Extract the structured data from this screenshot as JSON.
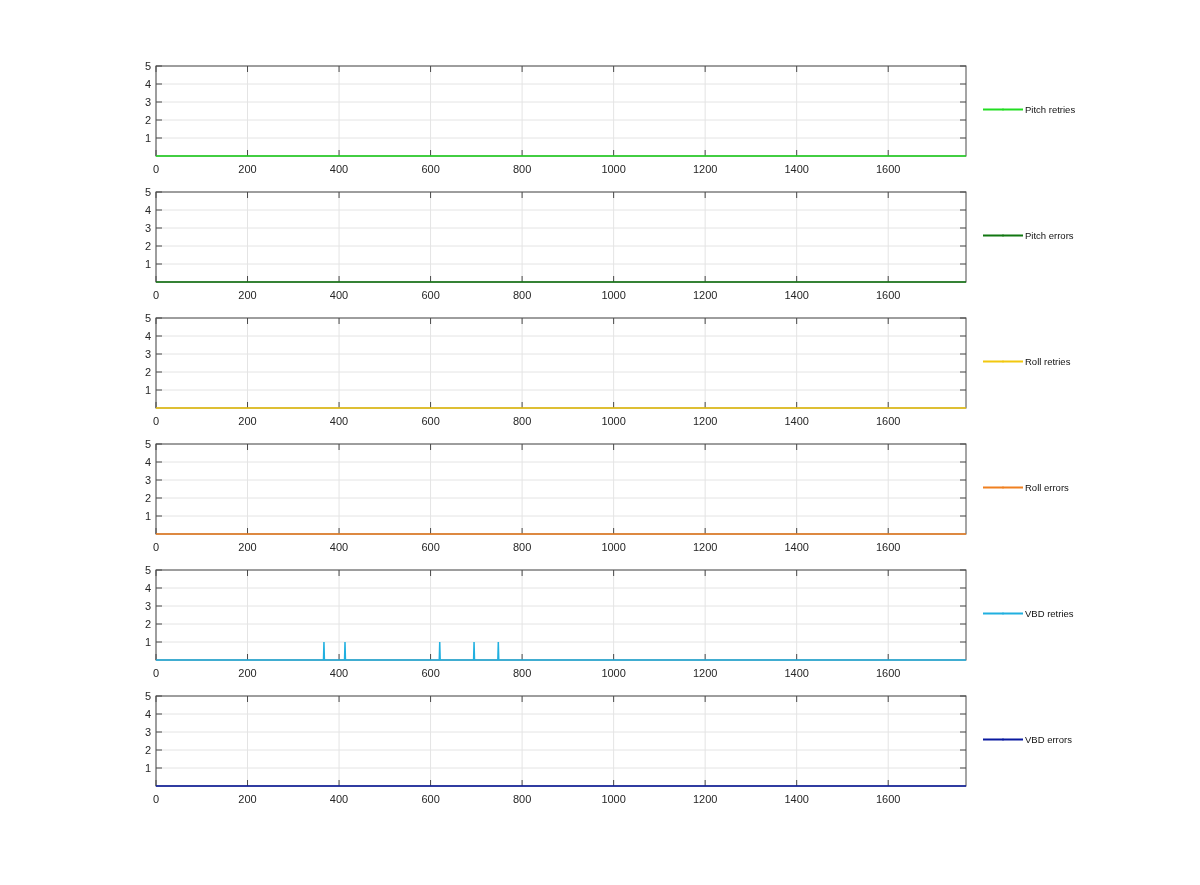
{
  "charts": [
    {
      "chart_data": {
        "type": "line",
        "x": [
          0,
          1770
        ],
        "series": [
          {
            "name": "Pitch retries",
            "color": "#22dd22",
            "values": [
              0,
              0
            ]
          }
        ],
        "xlim": [
          0,
          1770
        ],
        "ylim": [
          0,
          5
        ],
        "xticks": [
          0,
          200,
          400,
          600,
          800,
          1000,
          1200,
          1400,
          1600
        ],
        "yticks": [
          1,
          2,
          3,
          4,
          5
        ],
        "grid": true
      }
    },
    {
      "chart_data": {
        "type": "line",
        "x": [
          0,
          1770
        ],
        "series": [
          {
            "name": "Pitch errors",
            "color": "#117711",
            "values": [
              0,
              0
            ]
          }
        ],
        "xlim": [
          0,
          1770
        ],
        "ylim": [
          0,
          5
        ],
        "xticks": [
          0,
          200,
          400,
          600,
          800,
          1000,
          1200,
          1400,
          1600
        ],
        "yticks": [
          1,
          2,
          3,
          4,
          5
        ],
        "grid": true
      }
    },
    {
      "chart_data": {
        "type": "line",
        "x": [
          0,
          1770
        ],
        "series": [
          {
            "name": "Roll retries",
            "color": "#f2c80f",
            "values": [
              0,
              0
            ]
          }
        ],
        "xlim": [
          0,
          1770
        ],
        "ylim": [
          0,
          5
        ],
        "xticks": [
          0,
          200,
          400,
          600,
          800,
          1000,
          1200,
          1400,
          1600
        ],
        "yticks": [
          1,
          2,
          3,
          4,
          5
        ],
        "grid": true
      }
    },
    {
      "chart_data": {
        "type": "line",
        "x": [
          0,
          1770
        ],
        "series": [
          {
            "name": "Roll errors",
            "color": "#f08020",
            "values": [
              0,
              0
            ]
          }
        ],
        "xlim": [
          0,
          1770
        ],
        "ylim": [
          0,
          5
        ],
        "xticks": [
          0,
          200,
          400,
          600,
          800,
          1000,
          1200,
          1400,
          1600
        ],
        "yticks": [
          1,
          2,
          3,
          4,
          5
        ],
        "grid": true
      }
    },
    {
      "chart_data": {
        "type": "line",
        "x": [
          0,
          366,
          367,
          368,
          412,
          413,
          414,
          619,
          620,
          621,
          694,
          695,
          696,
          747,
          748,
          749,
          1770
        ],
        "series": [
          {
            "name": "VBD retries",
            "color": "#20b0e0",
            "values": [
              0,
              0,
              1,
              0,
              0,
              1,
              0,
              0,
              1,
              0,
              0,
              1,
              0,
              0,
              1,
              0,
              0
            ]
          }
        ],
        "xlim": [
          0,
          1770
        ],
        "ylim": [
          0,
          5
        ],
        "xticks": [
          0,
          200,
          400,
          600,
          800,
          1000,
          1200,
          1400,
          1600
        ],
        "yticks": [
          1,
          2,
          3,
          4,
          5
        ],
        "grid": true
      }
    },
    {
      "chart_data": {
        "type": "line",
        "x": [
          0,
          1770
        ],
        "series": [
          {
            "name": "VBD errors",
            "color": "#0a1aa0",
            "values": [
              0,
              0
            ]
          }
        ],
        "xlim": [
          0,
          1770
        ],
        "ylim": [
          0,
          5
        ],
        "xticks": [
          0,
          200,
          400,
          600,
          800,
          1000,
          1200,
          1400,
          1600
        ],
        "yticks": [
          1,
          2,
          3,
          4,
          5
        ],
        "grid": true
      }
    }
  ]
}
